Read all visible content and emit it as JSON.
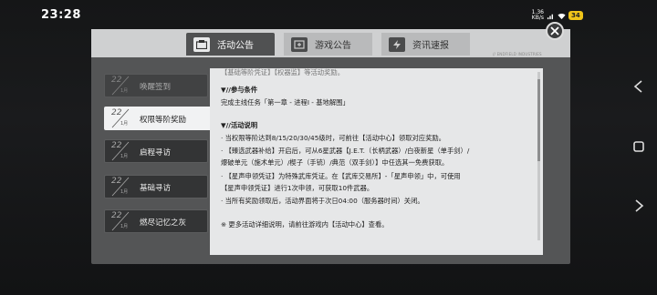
{
  "status_bar": {
    "time": "23:28",
    "net_speed_value": "1.36",
    "net_speed_unit": "KB/s",
    "battery": "34"
  },
  "dialog": {
    "brand": "// ENDFIELD INDUSTRIES",
    "tabs": [
      {
        "label": "活动公告",
        "active": true
      },
      {
        "label": "游戏公告",
        "active": false
      },
      {
        "label": "资讯速报",
        "active": false
      }
    ],
    "sidebar": [
      {
        "day": "22",
        "month": "1月",
        "label": "唤醒签到",
        "state": "faded"
      },
      {
        "day": "22",
        "month": "1月",
        "label": "权限等阶奖励",
        "state": "active"
      },
      {
        "day": "22",
        "month": "1月",
        "label": "启程寻访",
        "state": "normal"
      },
      {
        "day": "22",
        "month": "1月",
        "label": "基础寻访",
        "state": "normal"
      },
      {
        "day": "22",
        "month": "1月",
        "label": "燃尽记忆之灰",
        "state": "normal"
      }
    ],
    "content": {
      "top_cut": "【基础等阶凭证】【权器监】等活动奖励。",
      "participation_title": "▼//参与条件",
      "participation_text": "完成主线任务「第一章 - 进程Ⅰ - 基地解围」",
      "desc_title": "▼//活动说明",
      "desc_lines": [
        "· 当权限等阶达到8/15/20/30/45级时，可前往【活动中心】领取对应奖励。",
        "· 【臻选武器补给】开启后，可从6星武器【J.E.T.（长柄武器）/白夜新星（单手剑）/",
        "爆破单元（施术单元）/楔子（手铳）/典范（双手剑）】中任选其一免费获取。",
        "· 【星声申领凭证】为特殊武库凭证。在【武库交易所】-「星声申领」中，可使用",
        "【星声申领凭证】进行1次申领，可获取10件武器。",
        "· 当所有奖励领取后，活动界面将于次日04:00（服务器时间）关闭。"
      ],
      "footer_note": "※ 更多活动详细说明，请前往游戏内【活动中心】查看。"
    }
  },
  "icons": {
    "close": "close-icon",
    "back": "back-triangle-icon",
    "home": "home-circle-icon",
    "recents": "recents-square-icon",
    "wifi": "wifi-icon",
    "signal": "signal-icon"
  },
  "colors": {
    "header_bg": "#cfd0d1",
    "panel_bg": "#545556",
    "content_bg": "#e6e7e8",
    "battery": "#f0c419"
  }
}
